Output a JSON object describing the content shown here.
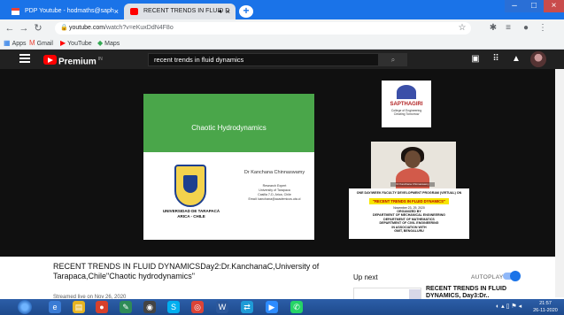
{
  "browser": {
    "tabs": [
      {
        "label": "PDP Youtube - hodmaths@saph",
        "active": false
      },
      {
        "label": "RECENT TRENDS IN FLUID D",
        "active": true
      }
    ],
    "url_host": "youtube.com",
    "url_path": "/watch?v=eKuxDdN4F8o",
    "bookmarks": [
      "Apps",
      "Gmail",
      "YouTube",
      "Maps"
    ]
  },
  "youtube": {
    "brand": "Premium",
    "search_value": "recent trends in fluid dynamics",
    "video_title": "RECENT TRENDS IN FLUID DYNAMICSDay2:Dr.KanchanaC,University of Tarapaca,Chile\"Chaotic hydrodynamics\"",
    "date": "Streamed live on Nov 26, 2020",
    "up_next_label": "Up next",
    "autoplay_label": "AUTOPLAY",
    "autoplay_on": true,
    "next_video_title": "RECENT TRENDS IN FLUID DYNAMICS, Day3:Dr.."
  },
  "slide": {
    "title": "Chaotic Hydrodynamics",
    "speaker": "Dr Kanchana Chinnaswamy",
    "info_lines": [
      "Research Expert",
      "University of Tarapaca",
      "Casilla 7-D, Arica, Chile",
      "Email: kanchana@academicos.uta.cl"
    ],
    "university_lines": [
      "UNIVERSIDAD DE TARAPACÁ",
      "ARICA - CHILE"
    ]
  },
  "overlay": {
    "logo_name": "SAPTHAGIRI",
    "logo_sub": [
      "College of Engineering",
      "Creating Tomorrow"
    ],
    "poster_top": "ONE DAY/WEEK FACULTY DEVELOPMENT PROGRAM (VIRTUAL) ON",
    "poster_title": "\"RECENT TRENDS IN FLUID DYNAMICS\"",
    "poster_date": "November 23- 29, 2020",
    "poster_lines": [
      "ORGANIZED BY",
      "DEPARTMENT OF MECHANICAL ENGINEERING",
      "DEPARTMENT OF MATHEMATICS",
      "DEPARTMENT OF CIVIL ENGINEERING",
      "IN ASSOCIATION WITH",
      "GMIT, BENGALURU"
    ]
  },
  "taskbar": {
    "time": "21:57",
    "date": "26-11-2020"
  },
  "colors": {
    "chrome_blue": "#1a73e8",
    "yt_dark": "#212121",
    "slide_green": "#4aa64a",
    "yt_red": "#ff0000"
  }
}
